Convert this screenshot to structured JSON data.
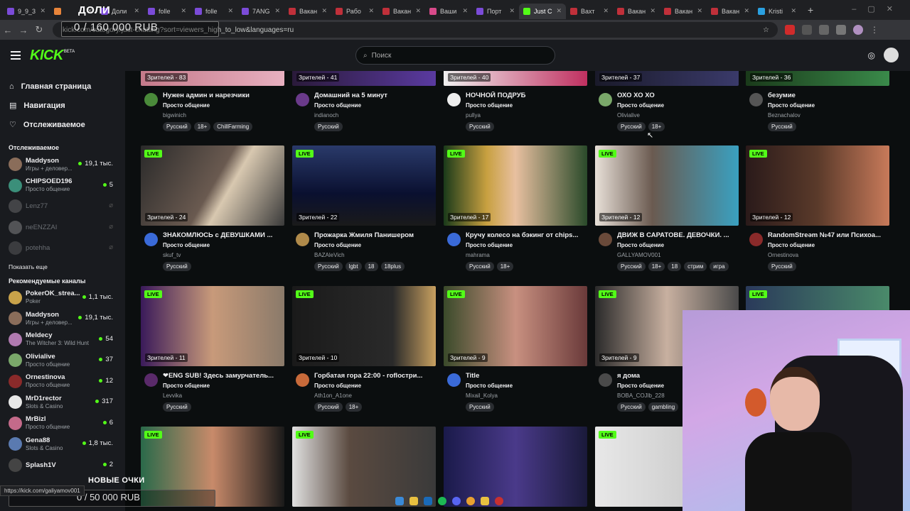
{
  "browser": {
    "tabs": [
      "9_9_3",
      "",
      "Доли",
      "folle",
      "folle",
      "7ANG",
      "Вакан",
      "Рабо",
      "Вакан",
      "Ваши",
      "Порт",
      "Just C",
      "Вахт",
      "Вакан",
      "Вакан",
      "Вакан",
      "Kristi"
    ],
    "url": "kick.com/category/just-chatting?sort=viewers_high_to_low&languages=ru"
  },
  "overlay": {
    "top_label": "ДОЛИ",
    "top_goal": "0 / 160 000 RUB",
    "bottom_label": "НОВЫЕ ОЧКИ",
    "bottom_goal": "0 / 50 000 RUB"
  },
  "header": {
    "logo": "KICK",
    "beta": "BETA",
    "search_placeholder": "Поиск"
  },
  "sidebar": {
    "nav": [
      "Главная страница",
      "Навигация",
      "Отслеживаемое"
    ],
    "following_title": "Отслеживаемое",
    "following": [
      {
        "name": "Maddyson",
        "category": "Игры + деловер...",
        "viewers": "19,1 тыс.",
        "online": true,
        "color": "#8a6d5a"
      },
      {
        "name": "CHIPSOED196",
        "category": "Просто общение",
        "viewers": "5",
        "online": true,
        "color": "#3b8f7a"
      },
      {
        "name": "Lenz77",
        "category": "",
        "viewers": "",
        "online": false,
        "color": "#777"
      },
      {
        "name": "neENZZAI",
        "category": "",
        "viewers": "",
        "online": false,
        "color": "#999"
      },
      {
        "name": "potehha",
        "category": "",
        "viewers": "",
        "online": false,
        "color": "#666"
      }
    ],
    "show_more": "Показать еще",
    "recommended_title": "Рекомендуемые каналы",
    "recommended": [
      {
        "name": "PokerOK_strea...",
        "category": "Poker",
        "viewers": "1,1 тыс.",
        "color": "#c9a34a"
      },
      {
        "name": "Maddyson",
        "category": "Игры + деловер...",
        "viewers": "19,1 тыс.",
        "color": "#8a6d5a"
      },
      {
        "name": "Meldecy",
        "category": "The Witcher 3: Wild Hunt",
        "viewers": "54",
        "color": "#b07ab0"
      },
      {
        "name": "Olivialive",
        "category": "Просто общение",
        "viewers": "37",
        "color": "#7aa86a"
      },
      {
        "name": "Ornestinova",
        "category": "Просто общение",
        "viewers": "12",
        "color": "#8a2a2a"
      },
      {
        "name": "MrD1rector",
        "category": "Slots & Casino",
        "viewers": "317",
        "color": "#e8e8e8"
      },
      {
        "name": "MrBizl",
        "category": "Просто общение",
        "viewers": "6",
        "color": "#c46a8a"
      },
      {
        "name": "Gena88",
        "category": "Slots & Casino",
        "viewers": "1,8 тыс.",
        "color": "#5a7ab0"
      },
      {
        "name": "Splash1V",
        "category": "",
        "viewers": "2",
        "color": "#444"
      }
    ]
  },
  "streams": [
    {
      "viewers": "Зрителей - 83",
      "live": false,
      "title": "Нужен админ и нарезчики",
      "category": "Просто общение",
      "user": "bigwinich",
      "tags": [
        "Русский",
        "18+",
        "ChillFarming"
      ],
      "thumb": "linear-gradient(90deg,#c47a8a,#e8b0c0)",
      "av": "#4a8a3a"
    },
    {
      "viewers": "Зрителей - 41",
      "live": false,
      "title": "Домашний на 5 минут",
      "category": "Просто общение",
      "user": "indianoch",
      "tags": [
        "Русский"
      ],
      "thumb": "linear-gradient(90deg,#2a1a3a,#5a3aa0)",
      "av": "#6a3a8a"
    },
    {
      "viewers": "Зрителей - 40",
      "live": false,
      "title": "НОЧНОЙ ПОДРУБ",
      "category": "Просто общение",
      "user": "pullya",
      "tags": [
        "Русский"
      ],
      "thumb": "linear-gradient(90deg,#f0f0f0,#c03060)",
      "av": "#eee"
    },
    {
      "viewers": "Зрителей - 37",
      "live": false,
      "title": "ОХО ХО ХО",
      "category": "Просто общение",
      "user": "Olivialive",
      "tags": [
        "Русский",
        "18+"
      ],
      "thumb": "linear-gradient(90deg,#1a1a2a,#3a3a6a)",
      "av": "#7aa86a"
    },
    {
      "viewers": "Зрителей - 36",
      "live": false,
      "title": "безумие",
      "category": "Просто общение",
      "user": "Beznachalov",
      "tags": [
        "Русский"
      ],
      "thumb": "linear-gradient(90deg,#1a3a1a,#3a8a4a)",
      "av": "#555"
    },
    {
      "viewers": "Зрителей - 24",
      "live": true,
      "title": "ЗНАКОМЛЮСЬ с ДЕВУШКАМИ ...",
      "category": "Просто общение",
      "user": "skuf_tv",
      "tags": [
        "Русский"
      ],
      "thumb": "linear-gradient(120deg,#2a2a2a,#6a5a50 50%,#d8c8b0 60%,#3a3a3a)",
      "av": "#3a6ad8"
    },
    {
      "viewers": "Зрителей - 22",
      "live": true,
      "title": "Прожарка Жмиля Панишером",
      "category": "Просто общение",
      "user": "BAZAleVich",
      "tags": [
        "Русский",
        "lgbt",
        "18",
        "18plus"
      ],
      "thumb": "linear-gradient(180deg,#2a3a6a,#0a1030 60%,#1a1a1a)",
      "av": "#b08a4a"
    },
    {
      "viewers": "Зрителей - 17",
      "live": true,
      "title": "Кручу колесо на бэкинг от chips...",
      "category": "Просто общение",
      "user": "mahrama",
      "tags": [
        "Русский",
        "18+"
      ],
      "thumb": "linear-gradient(90deg,#1a3a1a,#c8a040 30%,#e8c0a0 50%,#2a4a2a)",
      "av": "#3a6ad8"
    },
    {
      "viewers": "Зрителей - 12",
      "live": true,
      "title": "ДВИЖ В САРАТОВЕ. ДЕВОЧКИ. ...",
      "category": "Просто общение",
      "user": "GALLYAMOV001",
      "tags": [
        "Русский",
        "18+",
        "18",
        "стрим",
        "игра"
      ],
      "thumb": "linear-gradient(90deg,#e8e0d8,#6a5a50 40%,#3aa0c0)",
      "av": "#6a4a3a"
    },
    {
      "viewers": "Зрителей - 12",
      "live": true,
      "title": "RandomStreәm №47 или Психоа...",
      "category": "Просто общение",
      "user": "Ornestinova",
      "tags": [
        "Русский"
      ],
      "thumb": "linear-gradient(90deg,#2a1a1a,#5a3a2a 50%,#c87a5a)",
      "av": "#8a2a2a"
    },
    {
      "viewers": "Зрителей - 11",
      "live": true,
      "title": "❤ENG SUB! Здесь замурчатель...",
      "category": "Просто общение",
      "user": "Levvika",
      "tags": [
        "Русский"
      ],
      "thumb": "linear-gradient(90deg,#3a1a5a,#c89a7a 50%,#8a7a6a)",
      "av": "#5a2a6a"
    },
    {
      "viewers": "Зрителей - 10",
      "live": true,
      "title": "Горбатая гора 22:00 - roflостри...",
      "category": "Просто общение",
      "user": "Ath1on_A1one",
      "tags": [
        "Русский",
        "18+"
      ],
      "thumb": "linear-gradient(90deg,#1a1a1a,#2a2a2a 70%,#c8a060)",
      "av": "#c86a3a"
    },
    {
      "viewers": "Зрителей - 9",
      "live": true,
      "title": "Title",
      "category": "Просто общение",
      "user": "Mixail_Kolya",
      "tags": [
        "Русский"
      ],
      "thumb": "linear-gradient(90deg,#3a4a2a,#c89080 50%,#6a3a3a)",
      "av": "#3a6ad8"
    },
    {
      "viewers": "Зрителей - 9",
      "live": true,
      "title": "я дома",
      "category": "Просто общение",
      "user": "BOBA_COJlb_228",
      "tags": [
        "Русский",
        "gambling"
      ],
      "thumb": "linear-gradient(90deg,#2a2a2a,#c8b0a0 50%,#4a4a4a)",
      "av": "#4a4a4a"
    },
    {
      "viewers": "",
      "live": true,
      "title": "",
      "category": "",
      "user": "",
      "tags": [],
      "thumb": "linear-gradient(90deg,#2a3a5a,#4a8a6a)",
      "av": "#444"
    },
    {
      "viewers": "",
      "live": true,
      "title": "",
      "category": "",
      "user": "",
      "tags": [],
      "thumb": "linear-gradient(90deg,#2a6a4a,#c88a6a 50%,#1a1a1a)",
      "av": "#444"
    },
    {
      "viewers": "",
      "live": true,
      "title": "",
      "category": "",
      "user": "",
      "tags": [],
      "thumb": "linear-gradient(90deg,#e0e0e0,#5a4a40 40%,#3a3a3a)",
      "av": "#444"
    },
    {
      "viewers": "",
      "live": false,
      "title": "",
      "category": "",
      "user": "",
      "tags": [],
      "thumb": "linear-gradient(90deg,#1a1a4a,#4a3a8a 50%,#1a1a3a)",
      "av": "#444"
    },
    {
      "viewers": "",
      "live": true,
      "title": "",
      "category": "",
      "user": "",
      "tags": [],
      "thumb": "linear-gradient(90deg,#e8e8e8,#c0c0c0)",
      "av": "#444"
    }
  ],
  "status_url": "https://kick.com/galiyamov001"
}
